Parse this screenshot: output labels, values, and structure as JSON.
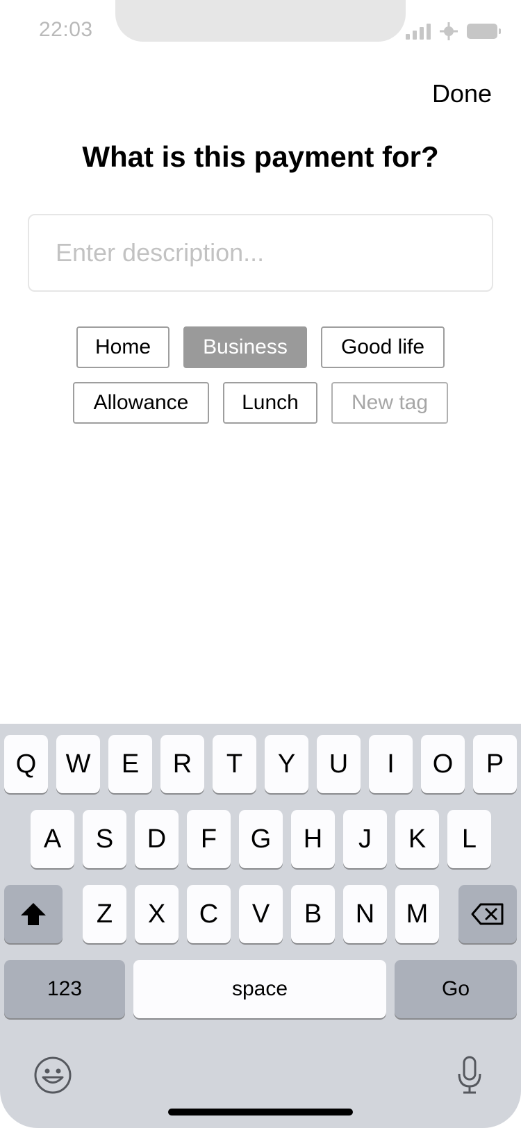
{
  "status_bar": {
    "time": "22:03"
  },
  "header": {
    "done_label": "Done",
    "title": "What is this payment for?"
  },
  "description": {
    "value": "",
    "placeholder": "Enter description..."
  },
  "tags": {
    "row1": [
      "Home",
      "Business",
      "Good life"
    ],
    "row2": [
      "Allowance",
      "Lunch"
    ],
    "selected": "Business",
    "new_tag_placeholder": "New tag"
  },
  "keyboard": {
    "row1": [
      "Q",
      "W",
      "E",
      "R",
      "T",
      "Y",
      "U",
      "I",
      "O",
      "P"
    ],
    "row2": [
      "A",
      "S",
      "D",
      "F",
      "G",
      "H",
      "J",
      "K",
      "L"
    ],
    "row3": [
      "Z",
      "X",
      "C",
      "V",
      "B",
      "N",
      "M"
    ],
    "numbers_label": "123",
    "space_label": "space",
    "go_label": "Go",
    "icons": {
      "shift": "shift-icon",
      "backspace": "backspace-icon",
      "emoji": "emoji-icon",
      "mic": "microphone-icon"
    }
  }
}
